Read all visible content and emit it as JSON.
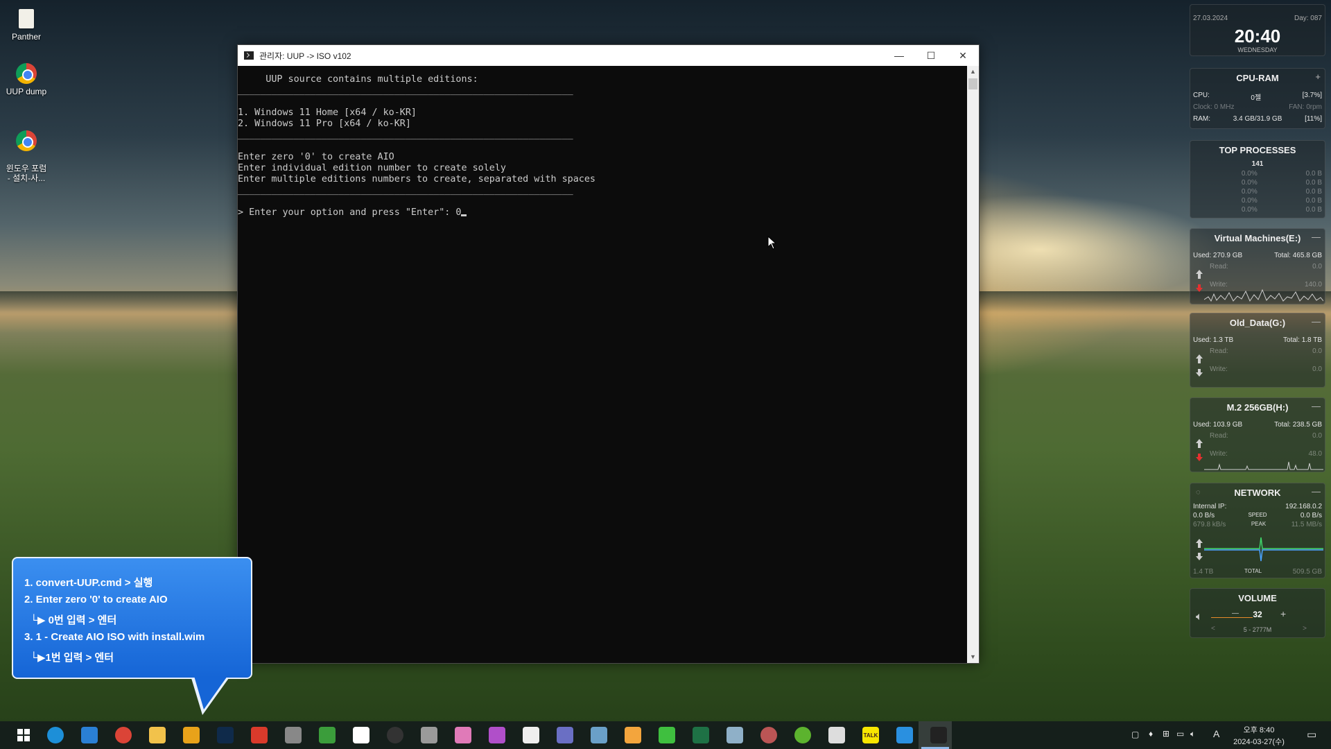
{
  "desktop": {
    "icons": [
      {
        "label": "Panther"
      },
      {
        "label": "UUP dump"
      },
      {
        "label": "윈도우 포럼\n- 설치-사..."
      }
    ]
  },
  "window": {
    "title": "관리자:  UUP -> ISO v102",
    "buttons": {
      "minimize": "—",
      "maximize": "☐",
      "close": "✕"
    }
  },
  "console": {
    "lines": [
      "     UUP source contains multiple editions:",
      "____________________________________________________________",
      "",
      "1. Windows 11 Home [x64 / ko-KR]",
      "2. Windows 11 Pro [x64 / ko-KR]",
      "____________________________________________________________",
      "",
      "Enter zero '0' to create AIO",
      "Enter individual edition number to create solely",
      "Enter multiple editions numbers to create, separated with spaces",
      "____________________________________________________________",
      "",
      "> Enter your option and press \"Enter\": 0"
    ]
  },
  "callout": {
    "lines": [
      "1. convert-UUP.cmd > 실행",
      "2. Enter zero '0' to create AIO",
      "  └▶ 0번 입력 > 엔터",
      "3. 1 - Create AIO ISO with install.wim",
      "  └▶1번 입력 > 엔터"
    ]
  },
  "gadgets": {
    "clock": {
      "date": "27.03.2024",
      "day": "Day: 087",
      "time": "20:40",
      "weekday": "WEDNESDAY"
    },
    "cpu_ram": {
      "title": "CPU-RAM",
      "ctrl": "+",
      "cpu_label": "CPU:",
      "cpu_name": "0젤",
      "cpu_pct": "[3.7%]",
      "clock_label": "Clock: 0 MHz",
      "fan_label": "FAN: 0rpm",
      "ram_label": "RAM:",
      "ram_used": "3.4 GB/31.9 GB",
      "ram_pct": "[11%]"
    },
    "top_processes": {
      "title": "TOP PROCESSES",
      "count": "141",
      "rows": [
        {
          "cpu": "0.0%",
          "mem": "0.0 B"
        },
        {
          "cpu": "0.0%",
          "mem": "0.0 B"
        },
        {
          "cpu": "0.0%",
          "mem": "0.0 B"
        },
        {
          "cpu": "0.0%",
          "mem": "0.0 B"
        },
        {
          "cpu": "0.0%",
          "mem": "0.0 B"
        }
      ]
    },
    "drives": [
      {
        "title": "Virtual Machines(E:)",
        "used": "Used: 270.9 GB",
        "total": "Total: 465.8 GB",
        "read_label": "Read:",
        "read_val": "0.0",
        "write_label": "Write:",
        "write_val": "140.0",
        "ctrl": "—"
      },
      {
        "title": "Old_Data(G:)",
        "used": "Used: 1.3 TB",
        "total": "Total: 1.8 TB",
        "read_label": "Read:",
        "read_val": "0.0",
        "write_label": "Write:",
        "write_val": "0.0",
        "ctrl": "—"
      },
      {
        "title": "M.2 256GB(H:)",
        "used": "Used: 103.9 GB",
        "total": "Total: 238.5 GB",
        "read_label": "Read:",
        "read_val": "0.0",
        "write_label": "Write:",
        "write_val": "48.0",
        "ctrl": "—"
      }
    ],
    "network": {
      "title": "NETWORK",
      "ctrl": "—",
      "ip_label": "Internal IP:",
      "ip": "192.168.0.2",
      "down_speed": "0.0 B/s",
      "speed_label": "SPEED",
      "up_speed": "0.0 B/s",
      "down_peak": "679.8 kB/s",
      "peak_label": "PEAK",
      "up_peak": "11.5 MB/s",
      "down_total": "1.4 TB",
      "total_label": "TOTAL",
      "up_total": "509.5 GB"
    },
    "volume": {
      "title": "VOLUME",
      "minus": "—",
      "value": "32",
      "plus": "+",
      "device": "5 - 2777M",
      "prev": "<",
      "next": ">"
    }
  },
  "taskbar": {
    "start_icon": "windows-start-icon",
    "apps": [
      "edge",
      "ie",
      "chrome",
      "file-explorer",
      "app-triangle",
      "photoshop",
      "app-red",
      "app-tools",
      "app-green",
      "app-c",
      "app-obs",
      "app-diamond",
      "app-pink",
      "app-info",
      "app-d",
      "app-hat",
      "app-folder",
      "app-pin",
      "app-green-diamond",
      "excel",
      "app-paper",
      "app-disc",
      "utorrent",
      "app-keyboard",
      "kakaotalk",
      "app-orange-box",
      "terminal"
    ],
    "kakao_label": "TALK",
    "tray": {
      "ampm_time": "오후 8:40",
      "date": "2024-03-27(수)",
      "ime": "A"
    }
  },
  "colors": {
    "console_bg": "#0c0c0c",
    "console_fg": "#cccccc",
    "callout_bg": "#1e70e0"
  }
}
